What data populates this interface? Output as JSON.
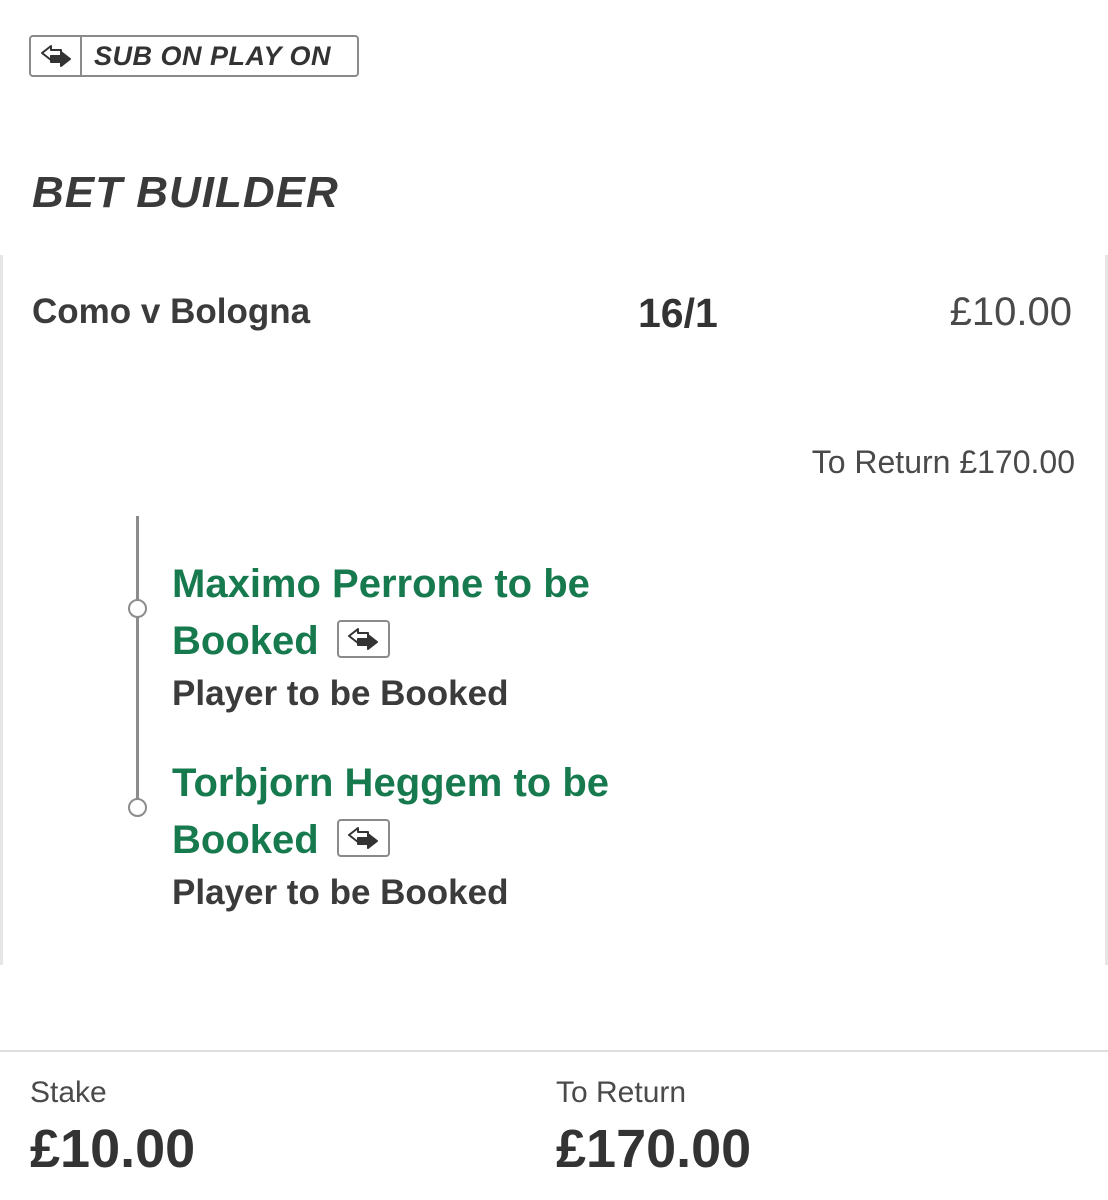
{
  "badge": {
    "label": "SUB ON PLAY ON",
    "icon": "sub-swap-icon"
  },
  "section": {
    "title": "BET BUILDER"
  },
  "bet": {
    "event": "Como v Bologna",
    "odds": "16/1",
    "stake": "£10.00",
    "to_return": "To Return £170.00",
    "legs": [
      {
        "selection": "Maximo Perrone to be Booked",
        "market": "Player to be Booked",
        "icon": "sub-swap-icon"
      },
      {
        "selection": "Torbjorn Heggem to be Booked",
        "market": "Player to be Booked",
        "icon": "sub-swap-icon"
      }
    ]
  },
  "footer": {
    "stake_label": "Stake",
    "stake_value": "£10.00",
    "return_label": "To Return",
    "return_value": "£170.00"
  },
  "colors": {
    "selection_green": "#177a4f",
    "text_dark": "#3b3b3b",
    "border_grey": "#8a8a8a"
  }
}
